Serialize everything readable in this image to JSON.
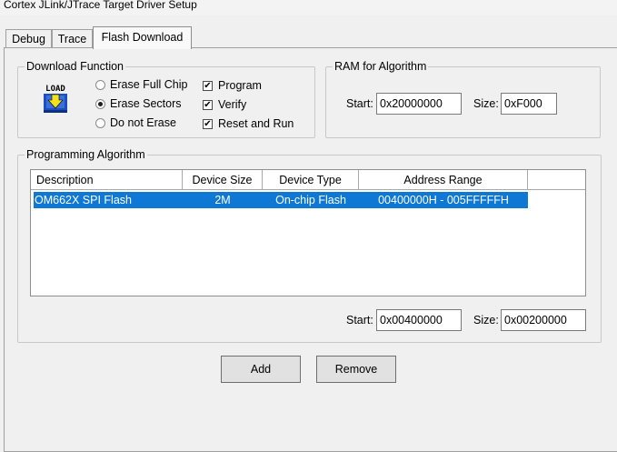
{
  "window": {
    "title": "Cortex JLink/JTrace Target Driver Setup"
  },
  "tabs": [
    {
      "label": "Debug"
    },
    {
      "label": "Trace"
    },
    {
      "label": "Flash Download"
    }
  ],
  "download_function": {
    "legend": "Download Function",
    "icon": "load-icon",
    "icon_text": "LOAD",
    "radios": [
      {
        "label": "Erase Full Chip",
        "selected": false
      },
      {
        "label": "Erase Sectors",
        "selected": true
      },
      {
        "label": "Do not Erase",
        "selected": false
      }
    ],
    "checks": [
      {
        "label": "Program",
        "checked": true,
        "mark": "✔"
      },
      {
        "label": "Verify",
        "checked": true,
        "mark": "✔"
      },
      {
        "label": "Reset and Run",
        "checked": true,
        "mark": "✔"
      }
    ]
  },
  "ram_for_algorithm": {
    "legend": "RAM for Algorithm",
    "start_label": "Start:",
    "start_value": "0x20000000",
    "size_label": "Size:",
    "size_value": "0xF000"
  },
  "programming_algorithm": {
    "legend": "Programming Algorithm",
    "columns": [
      "Description",
      "Device Size",
      "Device Type",
      "Address Range"
    ],
    "rows": [
      {
        "description": "OM662X SPI Flash",
        "device_size": "2M",
        "device_type": "On-chip Flash",
        "address_range": "00400000H - 005FFFFFH",
        "selected": true
      }
    ],
    "start_label": "Start:",
    "start_value": "0x00400000",
    "size_label": "Size:",
    "size_value": "0x00200000"
  },
  "buttons": {
    "add": "Add",
    "remove": "Remove"
  },
  "colors": {
    "selection": "#0e78d4",
    "background": "#f0f0f0"
  }
}
